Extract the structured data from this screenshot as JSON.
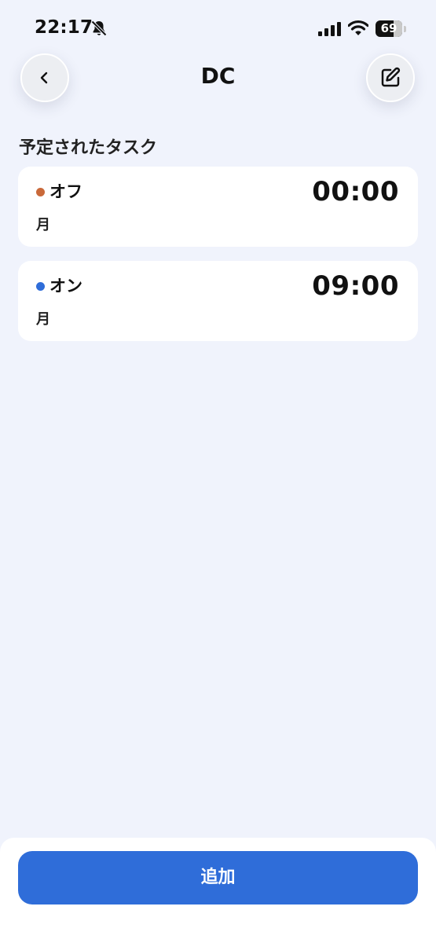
{
  "status_bar": {
    "time": "22:17",
    "battery_level": "69",
    "battery_fraction": 0.69
  },
  "header": {
    "title": "DC",
    "back_icon": "chevron-left-icon",
    "edit_icon": "edit-icon"
  },
  "section": {
    "title": "予定されたタスク"
  },
  "tasks": [
    {
      "name": "オフ",
      "time": "00:00",
      "days": "月",
      "dot_color": "#c9693a"
    },
    {
      "name": "オン",
      "time": "09:00",
      "days": "月",
      "dot_color": "#2f6dd9"
    }
  ],
  "footer": {
    "add_label": "追加"
  },
  "colors": {
    "background": "#f0f3fc",
    "accent": "#2f6dd9",
    "card": "#ffffff"
  }
}
